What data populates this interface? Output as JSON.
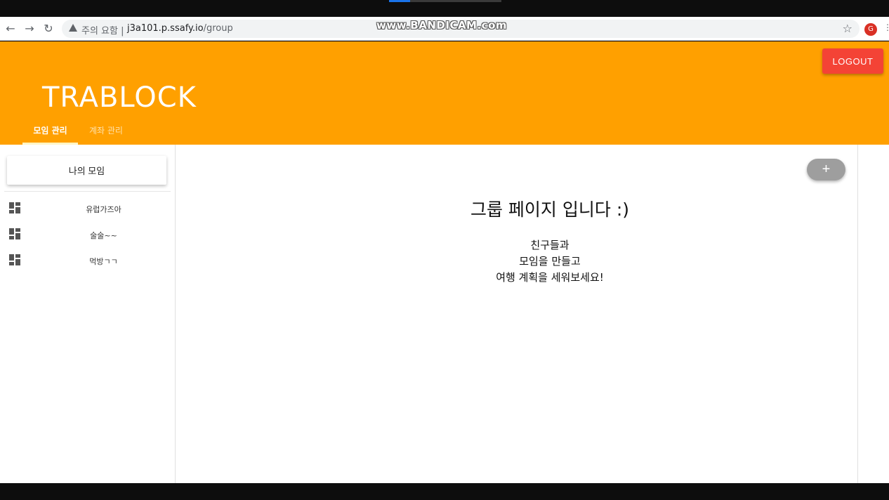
{
  "browser": {
    "security_warning": "주의 요함",
    "url_host": "j3a101.p.ssafy.io",
    "url_path": "/group",
    "avatar_letter": "G"
  },
  "watermark": "www.BANDICAM.com",
  "header": {
    "logo": "TRABLOCK",
    "logout_label": "LOGOUT",
    "tabs": [
      {
        "label": "모임 관리"
      },
      {
        "label": "계좌 관리"
      }
    ]
  },
  "sidebar": {
    "my_group_label": "나의 모임",
    "items": [
      {
        "label": "유럽가즈아"
      },
      {
        "label": "술술~~"
      },
      {
        "label": "먹방ㄱㄱ"
      }
    ]
  },
  "main": {
    "add_button_label": "+",
    "heading": "그룹 페이지 입니다 :)",
    "lines": [
      "친구들과",
      "모임을 만들고",
      "여행 계획을 세워보세요!"
    ]
  },
  "colors": {
    "appbar": "#ffa000",
    "logout": "#f44336",
    "fab": "#9e9e9e"
  }
}
